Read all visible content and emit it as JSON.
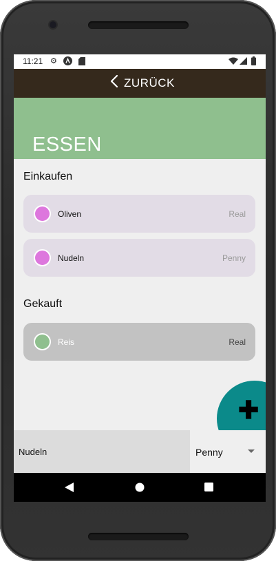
{
  "status_bar": {
    "time": "11:21",
    "left_icons": [
      "gear-icon",
      "app-logo-icon",
      "sd-card-icon"
    ],
    "right_icons": [
      "wifi-icon",
      "signal-icon",
      "battery-icon"
    ]
  },
  "app_bar": {
    "back_label": "ZURÜCK",
    "back_icon": "chevron-left-icon"
  },
  "header": {
    "title": "ESSEN",
    "color": "#8fbf8e"
  },
  "sections": {
    "shopping": {
      "title": "Einkaufen",
      "items": [
        {
          "name": "Oliven",
          "store": "Real",
          "dot_color": "#dd77dd"
        },
        {
          "name": "Nudeln",
          "store": "Penny",
          "dot_color": "#dd77dd"
        }
      ]
    },
    "bought": {
      "title": "Gekauft",
      "items": [
        {
          "name": "Reis",
          "store": "Real",
          "dot_color": "#8fbf8e"
        }
      ]
    }
  },
  "fab": {
    "icon": "plus-icon",
    "color": "#0b8a8a"
  },
  "input": {
    "item_value": "Nudeln",
    "store_value": "Penny"
  },
  "nav": [
    "back-triangle-icon",
    "home-circle-icon",
    "recents-square-icon"
  ]
}
